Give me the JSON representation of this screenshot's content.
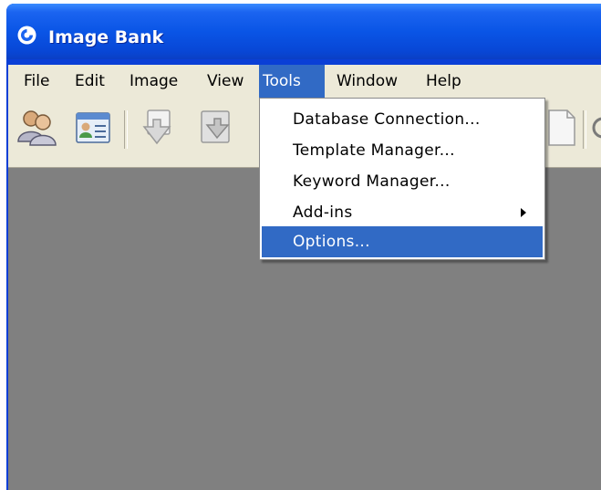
{
  "window": {
    "title": "Image Bank"
  },
  "menubar": {
    "items": [
      {
        "label": "File"
      },
      {
        "label": "Edit"
      },
      {
        "label": "Image"
      },
      {
        "label": "View"
      },
      {
        "label": "Tools",
        "active": true
      },
      {
        "label": "Window"
      },
      {
        "label": "Help"
      }
    ]
  },
  "toolbar": {
    "icons": [
      "users-icon",
      "contact-card-icon",
      "import-icon",
      "refresh-import-icon",
      "document-icon",
      "partial-icon"
    ]
  },
  "tools_menu": {
    "items": [
      {
        "label": "Database Connection..."
      },
      {
        "label": "Template Manager..."
      },
      {
        "label": "Keyword Manager..."
      },
      {
        "label": "Add-ins",
        "has_submenu": true
      },
      {
        "label": "Options...",
        "selected": true
      }
    ]
  },
  "colors": {
    "titlebar": "#0a55e6",
    "menu_highlight": "#316ac5",
    "chrome": "#ece9d8",
    "workspace": "#808080"
  }
}
